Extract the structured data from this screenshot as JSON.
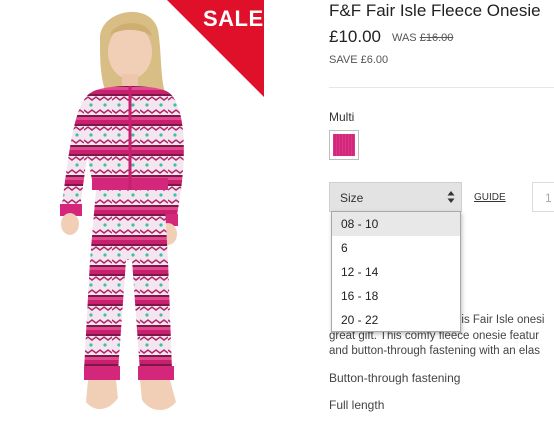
{
  "sale_badge": "SALE",
  "product": {
    "title": "F&F Fair Isle Fleece Onesie",
    "price": "£10.00",
    "was_label": "WAS",
    "was_price": "£16.00",
    "save_text": "SAVE £6.00"
  },
  "colour": {
    "label": "Multi",
    "swatch_color": "#d4267a"
  },
  "size": {
    "select_label": "Size",
    "options": [
      "08 - 10",
      "6",
      "12 - 14",
      "16 - 18",
      "20 - 22"
    ],
    "highlighted_option": "08 - 10"
  },
  "guide_link": "GUIDE",
  "quantity_value": "1",
  "description": {
    "line1": "his Fair Isle onesi",
    "line2": "great gift. This comfy fleece onesie featur",
    "line3": "and button-through fastening with an elas"
  },
  "features": [
    "Button-through fastening",
    "Full length"
  ],
  "colors": {
    "sale_red": "#e0102a",
    "onesie_pink": "#d4267a"
  }
}
